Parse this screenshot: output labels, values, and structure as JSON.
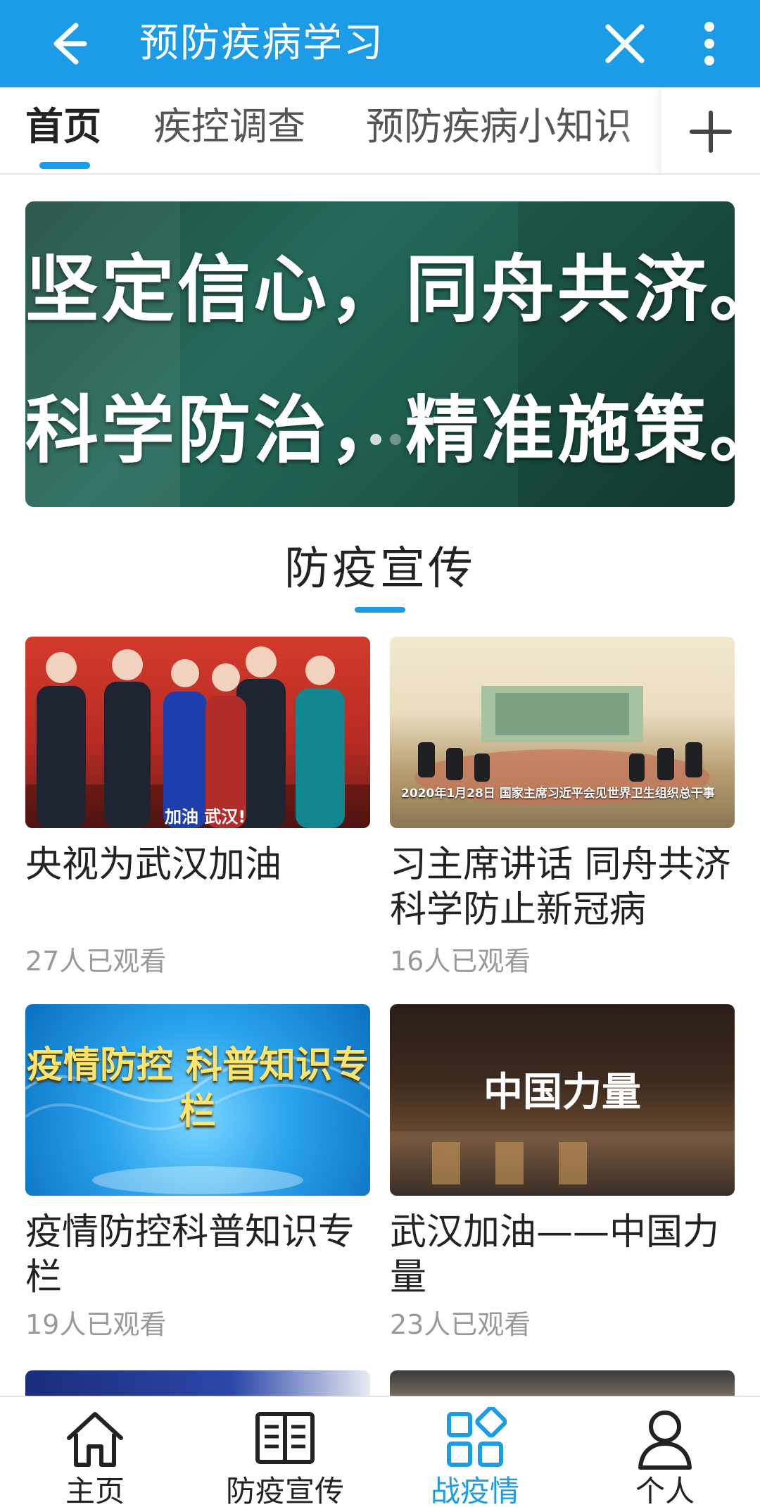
{
  "appbar": {
    "title": "预防疾病学习",
    "back_icon": "back-arrow-icon",
    "close_icon": "close-icon",
    "more_icon": "more-vertical-icon",
    "color": "#1c9be6"
  },
  "tabs": {
    "items": [
      {
        "label": "首页",
        "active": true
      },
      {
        "label": "疾控调查",
        "active": false
      },
      {
        "label": "预防疾病小知识",
        "active": false
      }
    ],
    "add_icon": "plus-icon"
  },
  "banner": {
    "line1": "坚定信心，同舟共济。",
    "line2": "科学防治，精准施策。"
  },
  "section": {
    "title": "防疫宣传"
  },
  "videos": [
    {
      "title": "央视为武汉加油",
      "views": "27人已观看",
      "caption": "加油 武汉!"
    },
    {
      "title": "习主席讲话 同舟共济科学防止新冠病",
      "views": "16人已观看",
      "caption": "2020年1月28日 国家主席习近平会见世界卫生组织总干事"
    },
    {
      "title": "疫情防控科普知识专栏",
      "views": "19人已观看",
      "caption": "疫情防控 科普知识专栏"
    },
    {
      "title": "武汉加油——中国力量",
      "views": "23人已观看",
      "caption": "中国力量"
    }
  ],
  "bottom_nav": {
    "items": [
      {
        "label": "主页",
        "icon": "home-icon",
        "active": false
      },
      {
        "label": "防疫宣传",
        "icon": "book-icon",
        "active": false
      },
      {
        "label": "战疫情",
        "icon": "apps-icon",
        "active": true
      },
      {
        "label": "个人",
        "icon": "person-icon",
        "active": false
      }
    ],
    "active_color": "#1c9be6"
  }
}
